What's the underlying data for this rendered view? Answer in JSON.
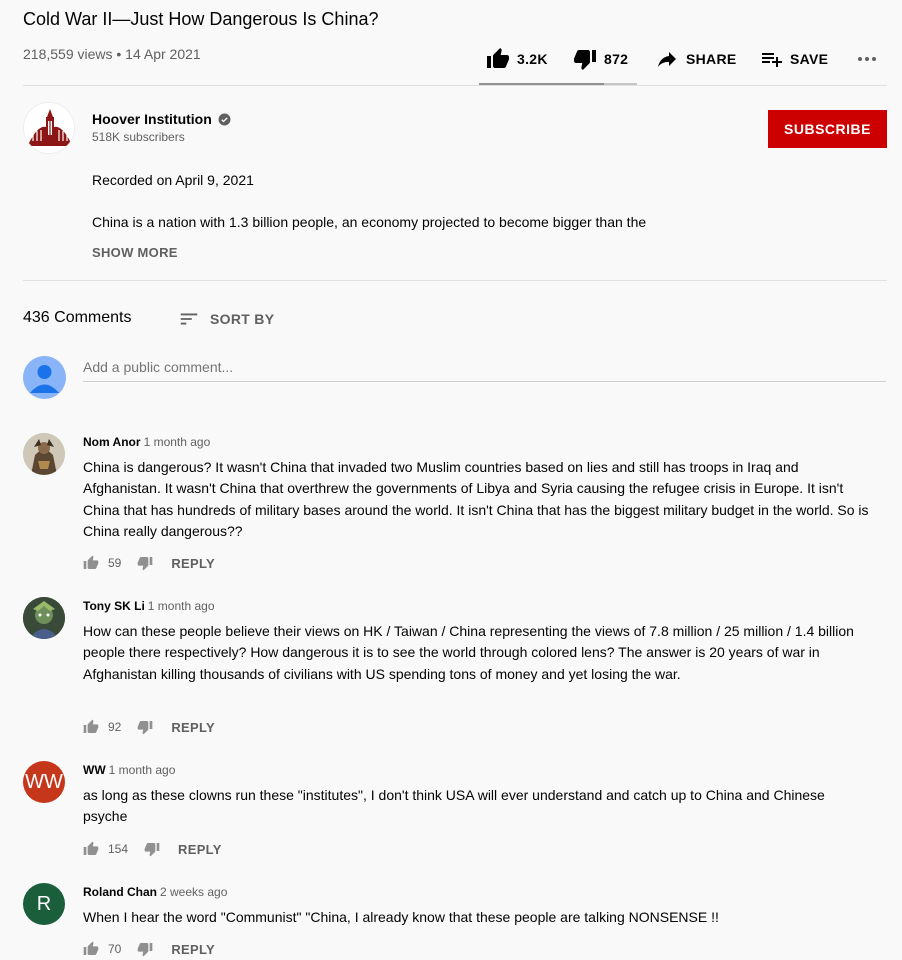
{
  "video": {
    "title": "Cold War II—Just How Dangerous Is China?",
    "meta": "218,559 views • 14 Apr 2021",
    "likes": "3.2K",
    "dislikes": "872",
    "share_label": "SHARE",
    "save_label": "SAVE",
    "like_ratio": 0.79
  },
  "channel": {
    "name": "Hoover Institution",
    "subscribers": "518K subscribers",
    "subscribe_label": "SUBSCRIBE",
    "subscribe_color": "#cc0000"
  },
  "description": {
    "line1": "Recorded on April 9, 2021",
    "line2": "China is a nation with 1.3 billion people, an economy projected to become bigger than the",
    "show_more": "SHOW MORE"
  },
  "comments_section": {
    "count": "436 Comments",
    "sort_label": "SORT BY",
    "add_placeholder": "Add a public comment..."
  },
  "comments": [
    {
      "author": "Nom Anor",
      "time": "1 month ago",
      "text": "China is dangerous? It wasn't China that invaded two Muslim countries based on lies and still has troops in Iraq and Afghanistan. It wasn't China that overthrew the governments of Libya and Syria causing the refugee crisis in Europe. It isn't China that has hundreds of military bases around the world. It isn't China that has the biggest military budget in the world. So is China really dangerous??",
      "likes": "59",
      "reply": "REPLY",
      "avatar": "figure-avatar"
    },
    {
      "author": "Tony SK Li",
      "time": "1 month ago",
      "text": "How can these people believe their views on HK / Taiwan / China representing the views of 7.8 million / 25 million / 1.4 billion people there respectively?  How dangerous it is to see the world through colored lens?  The answer is 20 years of war in Afghanistan killing thousands of civilians with US spending tons of money and yet losing the war.",
      "likes": "92",
      "reply": "REPLY",
      "avatar": "figure-avatar"
    },
    {
      "author": "WW",
      "time": "1 month ago",
      "text": "as long as these clowns run these \"institutes\", I don't think USA will ever understand and catch up to China and Chinese psyche",
      "likes": "154",
      "reply": "REPLY",
      "avatar_initials": "WW",
      "avatar_color": "#c5361b"
    },
    {
      "author": "Roland Chan",
      "time": "2 weeks ago",
      "text": "When I hear the word \"Communist\" \"China, I already know that these people are talking NONSENSE !!",
      "likes": "70",
      "reply": "REPLY",
      "avatar_initials": "R",
      "avatar_color": "#1b5e3b"
    }
  ]
}
